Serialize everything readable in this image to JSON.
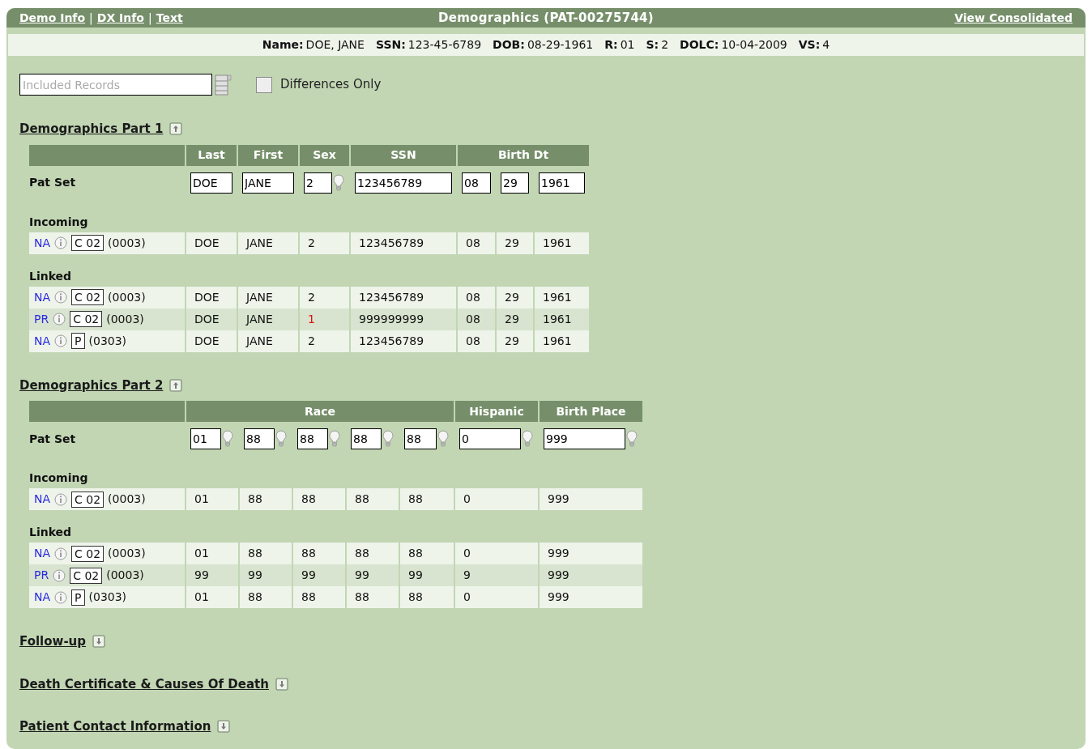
{
  "top_bar": {
    "links": [
      {
        "kind": "link",
        "text": "Demo Info"
      },
      {
        "kind": "separator",
        "text": "|"
      },
      {
        "kind": "link",
        "text": "DX Info"
      },
      {
        "kind": "separator",
        "text": "|"
      },
      {
        "kind": "link",
        "text": "Text"
      }
    ],
    "title": "Demographics (PAT-00275744)",
    "right_link": "View Consolidated"
  },
  "patient_info": [
    {
      "label": "Name:",
      "value": "DOE, JANE"
    },
    {
      "label": "SSN:",
      "value": "123-45-6789"
    },
    {
      "label": "DOB:",
      "value": "08-29-1961"
    },
    {
      "label": "R:",
      "value": "01"
    },
    {
      "label": "S:",
      "value": "2"
    },
    {
      "label": "DOLC:",
      "value": "10-04-2009"
    },
    {
      "label": "VS:",
      "value": "4"
    }
  ],
  "filter": {
    "placeholder": "Included Records",
    "checkbox_label": "Differences Only",
    "checked": false
  },
  "sections": [
    {
      "title": "Demographics Part 1",
      "expanded": true,
      "columns": [
        "Last",
        "First",
        "Sex",
        "SSN",
        "Birth Dt"
      ],
      "pat_set": {
        "label": "Pat Set",
        "fields": [
          {
            "value": "DOE",
            "hint": false
          },
          {
            "value": "JANE",
            "hint": false
          },
          {
            "value": "2",
            "hint": true
          },
          {
            "value": "123456789",
            "hint": false
          },
          {
            "value": "08",
            "hint": false
          },
          {
            "value": "29",
            "hint": false
          },
          {
            "value": "1961",
            "hint": false
          }
        ]
      },
      "groups": [
        {
          "label": "Incoming",
          "rows": [
            {
              "status": "NA",
              "code": "C 02",
              "count": "(0003)",
              "highlighted": false,
              "cells": [
                {
                  "text": "DOE",
                  "differs": false
                },
                {
                  "text": "JANE",
                  "differs": false
                },
                {
                  "text": "2",
                  "differs": false
                },
                {
                  "text": "123456789",
                  "differs": false
                },
                {
                  "text": "08",
                  "differs": false
                },
                {
                  "text": "29",
                  "differs": false
                },
                {
                  "text": "1961",
                  "differs": false
                }
              ]
            }
          ]
        },
        {
          "label": "Linked",
          "rows": [
            {
              "status": "NA",
              "code": "C 02",
              "count": "(0003)",
              "highlighted": false,
              "cells": [
                {
                  "text": "DOE",
                  "differs": false
                },
                {
                  "text": "JANE",
                  "differs": false
                },
                {
                  "text": "2",
                  "differs": false
                },
                {
                  "text": "123456789",
                  "differs": false
                },
                {
                  "text": "08",
                  "differs": false
                },
                {
                  "text": "29",
                  "differs": false
                },
                {
                  "text": "1961",
                  "differs": false
                }
              ]
            },
            {
              "status": "PR",
              "code": "C 02",
              "count": "(0003)",
              "highlighted": true,
              "cells": [
                {
                  "text": "DOE",
                  "differs": false
                },
                {
                  "text": "JANE",
                  "differs": false
                },
                {
                  "text": "1",
                  "differs": true
                },
                {
                  "text": "999999999",
                  "differs": false
                },
                {
                  "text": "08",
                  "differs": false
                },
                {
                  "text": "29",
                  "differs": false
                },
                {
                  "text": "1961",
                  "differs": false
                }
              ]
            },
            {
              "status": "NA",
              "code": "P",
              "count": "(0303)",
              "highlighted": false,
              "cells": [
                {
                  "text": "DOE",
                  "differs": false
                },
                {
                  "text": "JANE",
                  "differs": false
                },
                {
                  "text": "2",
                  "differs": false
                },
                {
                  "text": "123456789",
                  "differs": false
                },
                {
                  "text": "08",
                  "differs": false
                },
                {
                  "text": "29",
                  "differs": false
                },
                {
                  "text": "1961",
                  "differs": false
                }
              ]
            }
          ]
        }
      ]
    },
    {
      "title": "Demographics Part 2",
      "expanded": true,
      "columns": [
        "Race",
        "Hispanic",
        "Birth Place"
      ],
      "pat_set": {
        "label": "Pat Set",
        "fields": [
          {
            "value": "01",
            "hint": true
          },
          {
            "value": "88",
            "hint": true
          },
          {
            "value": "88",
            "hint": true
          },
          {
            "value": "88",
            "hint": true
          },
          {
            "value": "88",
            "hint": true
          },
          {
            "value": "0",
            "hint": true
          },
          {
            "value": "999",
            "hint": true
          }
        ]
      },
      "groups": [
        {
          "label": "Incoming",
          "rows": [
            {
              "status": "NA",
              "code": "C 02",
              "count": "(0003)",
              "highlighted": false,
              "cells": [
                {
                  "text": "01",
                  "differs": false
                },
                {
                  "text": "88",
                  "differs": false
                },
                {
                  "text": "88",
                  "differs": false
                },
                {
                  "text": "88",
                  "differs": false
                },
                {
                  "text": "88",
                  "differs": false
                },
                {
                  "text": "0",
                  "differs": false
                },
                {
                  "text": "999",
                  "differs": false
                }
              ]
            }
          ]
        },
        {
          "label": "Linked",
          "rows": [
            {
              "status": "NA",
              "code": "C 02",
              "count": "(0003)",
              "highlighted": false,
              "cells": [
                {
                  "text": "01",
                  "differs": false
                },
                {
                  "text": "88",
                  "differs": false
                },
                {
                  "text": "88",
                  "differs": false
                },
                {
                  "text": "88",
                  "differs": false
                },
                {
                  "text": "88",
                  "differs": false
                },
                {
                  "text": "0",
                  "differs": false
                },
                {
                  "text": "999",
                  "differs": false
                }
              ]
            },
            {
              "status": "PR",
              "code": "C 02",
              "count": "(0003)",
              "highlighted": true,
              "cells": [
                {
                  "text": "99",
                  "differs": false
                },
                {
                  "text": "99",
                  "differs": false
                },
                {
                  "text": "99",
                  "differs": false
                },
                {
                  "text": "99",
                  "differs": false
                },
                {
                  "text": "99",
                  "differs": false
                },
                {
                  "text": "9",
                  "differs": false
                },
                {
                  "text": "999",
                  "differs": false
                }
              ]
            },
            {
              "status": "NA",
              "code": "P",
              "count": "(0303)",
              "highlighted": false,
              "cells": [
                {
                  "text": "01",
                  "differs": false
                },
                {
                  "text": "88",
                  "differs": false
                },
                {
                  "text": "88",
                  "differs": false
                },
                {
                  "text": "88",
                  "differs": false
                },
                {
                  "text": "88",
                  "differs": false
                },
                {
                  "text": "0",
                  "differs": false
                },
                {
                  "text": "999",
                  "differs": false
                }
              ]
            }
          ]
        }
      ]
    },
    {
      "title": "Follow-up",
      "expanded": false
    },
    {
      "title": "Death Certificate & Causes Of Death",
      "expanded": false
    },
    {
      "title": "Patient Contact Information",
      "expanded": false
    }
  ]
}
